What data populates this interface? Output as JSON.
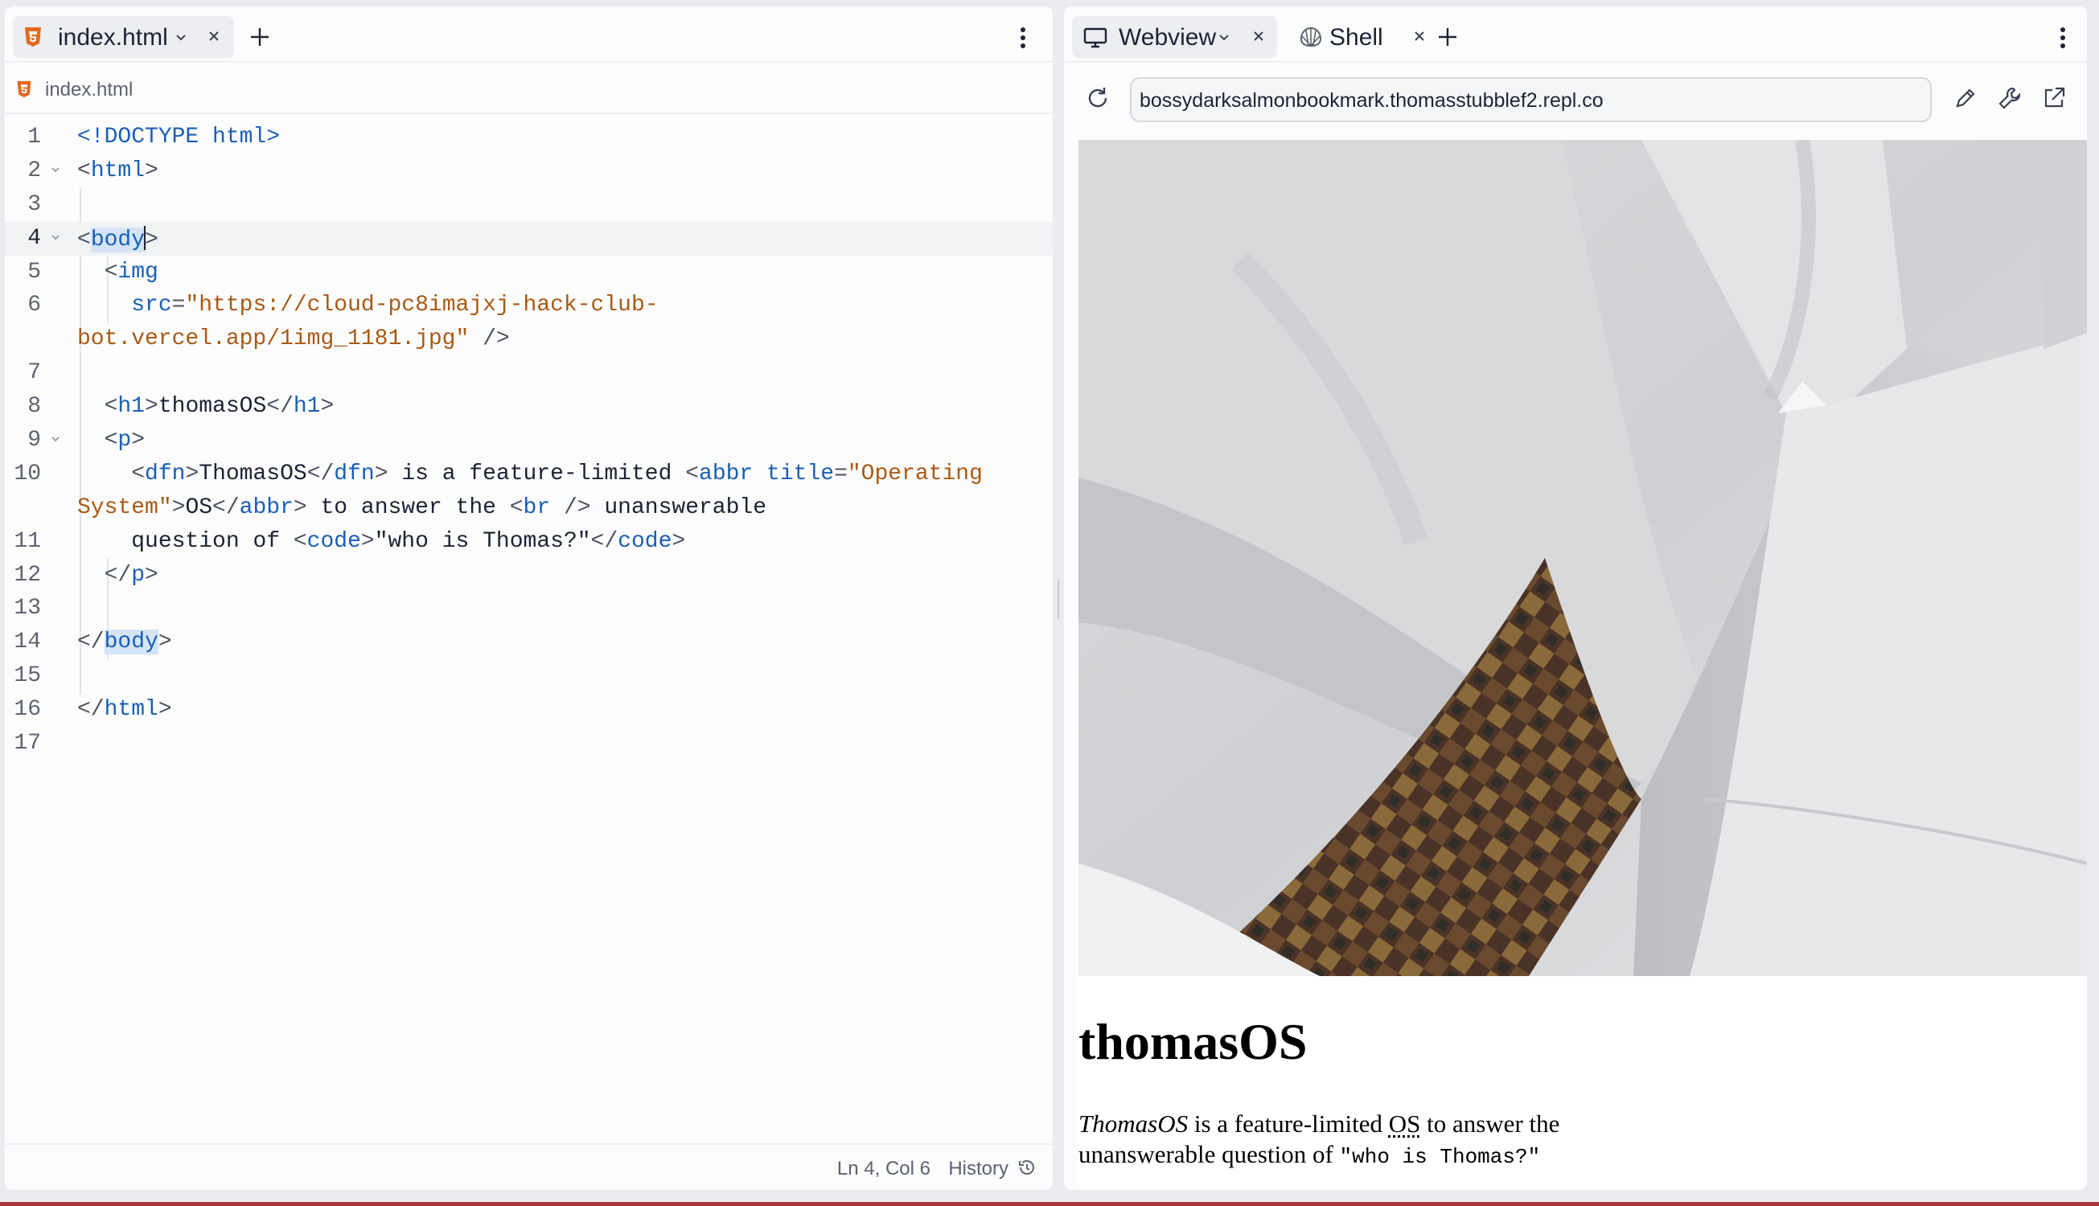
{
  "editor": {
    "tab": {
      "label": "index.html",
      "icon": "html5-icon"
    },
    "breadcrumb": "index.html",
    "status": {
      "cursor": "Ln 4, Col 6",
      "history_label": "History"
    },
    "code": {
      "line_numbers": [
        "1",
        "2",
        "3",
        "4",
        "5",
        "6",
        "7",
        "8",
        "9",
        "10",
        "11",
        "12",
        "13",
        "14",
        "15",
        "16",
        "17"
      ],
      "l1": "<!DOCTYPE html>",
      "l2_open": "<",
      "l2_tag": "html",
      "l2_close": ">",
      "l4_open": "<",
      "l4_tag": "body",
      "l4_close": ">",
      "l5_open": "<",
      "l5_tag": "img",
      "l6_attr": "src",
      "l6_eq": "=",
      "l6_str_a": "\"https://cloud-pc8imajxj-hack-club-",
      "l6_str_b": "bot.vercel.app/1img_1181.jpg\"",
      "l6_end": " />",
      "l8_a": "<",
      "l8_tag": "h1",
      "l8_b": ">",
      "l8_text": "thomasOS",
      "l8_c": "</",
      "l8_tag2": "h1",
      "l8_d": ">",
      "l9_a": "<",
      "l9_tag": "p",
      "l9_b": ">",
      "l10_a": "<",
      "l10_tag": "dfn",
      "l10_b": ">",
      "l10_text1": "ThomasOS",
      "l10_c": "</",
      "l10_tag2": "dfn",
      "l10_d": ">",
      "l10_text2": " is a feature-limited ",
      "l10_e": "<",
      "l10_tag3": "abbr",
      "l10_attr": " title",
      "l10_eq": "=",
      "l10_str_a": "\"Operating",
      "l10_str_b": "System\"",
      "l10_f": ">",
      "l10_text3": "OS",
      "l10_g": "</",
      "l10_tag4": "abbr",
      "l10_h": ">",
      "l10_text4": " to answer the ",
      "l10_i": "<",
      "l10_tag5": "br",
      "l10_j": " />",
      "l10_text5": " unanswerable",
      "l11_text": "question of ",
      "l11_a": "<",
      "l11_tag": "code",
      "l11_b": ">",
      "l11_text2": "\"who is Thomas?\"",
      "l11_c": "</",
      "l11_tag2": "code",
      "l11_d": ">",
      "l12_a": "</",
      "l12_tag": "p",
      "l12_b": ">",
      "l14_a": "</",
      "l14_tag": "body",
      "l14_b": ">",
      "l16_a": "</",
      "l16_tag": "html",
      "l16_b": ">"
    }
  },
  "preview": {
    "tabs": [
      {
        "label": "Webview",
        "icon": "monitor-icon"
      },
      {
        "label": "Shell",
        "icon": "shell-icon"
      }
    ],
    "url": "bossydarksalmonbookmark.thomasstubblef2.repl.co",
    "page": {
      "title": "thomasOS",
      "dfn": "ThomasOS",
      "text1": " is a feature-limited ",
      "abbr": "OS",
      "abbr_title": "Operating System",
      "text2": " to answer the",
      "text3": "unanswerable question of ",
      "code": "\"who is Thomas?\""
    }
  },
  "colors": {
    "accent": "#1a5fb4",
    "string": "#a85a14",
    "bottom_strip": "#a8363b"
  }
}
